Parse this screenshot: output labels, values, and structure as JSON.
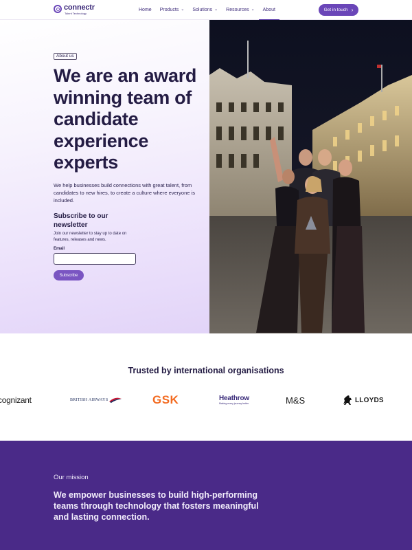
{
  "nav": {
    "logo": {
      "name": "connectr",
      "tagline": "Talent Technology"
    },
    "links": [
      {
        "label": "Home",
        "has_dropdown": false
      },
      {
        "label": "Products",
        "has_dropdown": true
      },
      {
        "label": "Solutions",
        "has_dropdown": true
      },
      {
        "label": "Resources",
        "has_dropdown": true
      },
      {
        "label": "About",
        "has_dropdown": false,
        "active": true
      }
    ],
    "cta_label": "Get in touch"
  },
  "hero": {
    "badge": "About us",
    "title": "We are an award winning team of candidate experience experts",
    "body": "We help businesses build connections with great talent, from candidates to new hires, to create a culture where everyone is included.",
    "subscribe": {
      "title": "Subscribe to our newsletter",
      "body": "Join our newsletter to stay up to date on features, releases and news.",
      "email_label": "Email",
      "email_value": "",
      "button_label": "Subscribe"
    }
  },
  "trusted": {
    "title": "Trusted by international organisations",
    "logos": [
      {
        "name": "cognizant",
        "icon": "cognizant-logo"
      },
      {
        "name": "BRITISH AIRWAYS",
        "icon": "british-airways-logo"
      },
      {
        "name": "GSK",
        "icon": "gsk-logo"
      },
      {
        "name": "Heathrow",
        "tagline": "Making every journey better",
        "icon": "heathrow-logo"
      },
      {
        "name": "M&S",
        "icon": "ms-logo"
      },
      {
        "name": "LLOYDS",
        "icon": "lloyds-horse-logo"
      }
    ]
  },
  "mission": {
    "label": "Our mission",
    "text": "We empower businesses to build high-performing teams through technology that fosters meaningful and lasting connection."
  },
  "colors": {
    "brand_purple": "#6a46b8",
    "mission_bg": "#4a2a88",
    "heading": "#241c44",
    "gsk_orange": "#f36b21"
  }
}
